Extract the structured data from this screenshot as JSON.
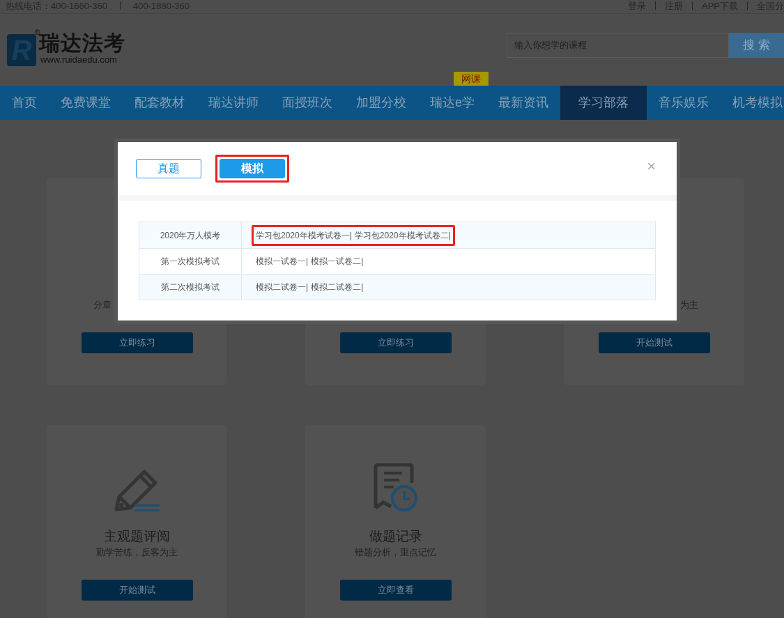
{
  "top_bar": {
    "hotline_label": "热线电话：",
    "phones": [
      "400-1660-360",
      "400-1880-360"
    ],
    "links": [
      "登录",
      "注册",
      "APP下载",
      "全国分"
    ]
  },
  "header": {
    "logo": {
      "mark": "R",
      "registered": "®",
      "name": "瑞达法考",
      "url": "www.ruidaedu.com"
    },
    "search": {
      "placeholder": "输入你想学的课程",
      "button": "搜 索"
    }
  },
  "nav": [
    {
      "label": "首页",
      "selected": false
    },
    {
      "label": "免费课堂",
      "selected": false
    },
    {
      "label": "配套教材",
      "selected": false
    },
    {
      "label": "瑞达讲师",
      "selected": false
    },
    {
      "label": "面授班次",
      "selected": false
    },
    {
      "label": "加盟分校",
      "selected": false
    },
    {
      "label": "瑞达e学",
      "selected": false,
      "badge": "网课"
    },
    {
      "label": "最新资讯",
      "selected": false
    },
    {
      "label": "学习部落",
      "selected": true
    },
    {
      "label": "音乐娱乐",
      "selected": false
    },
    {
      "label": "机考模拟",
      "selected": false
    }
  ],
  "cards": [
    {
      "subtitle": "分章",
      "button": "立即练习"
    },
    {
      "button": "立即练习"
    },
    {
      "subtitle": "为主",
      "button": "开始测试"
    },
    {
      "title": "主观题评阅",
      "subtitle": "勤学苦练，反客为主",
      "button": "开始测试"
    },
    {
      "title": "做题记录",
      "subtitle": "错题分析，重点记忆",
      "button": "立即查看"
    }
  ],
  "modal": {
    "close": "×",
    "tabs": [
      {
        "label": "真题",
        "selected": false,
        "highlighted": false
      },
      {
        "label": "模拟",
        "selected": true,
        "highlighted": true
      }
    ],
    "rows": [
      {
        "name": "2020年万人模考",
        "papers": [
          "学习包2020年模考试卷一|",
          "学习包2020年模考试卷二|"
        ],
        "highlighted": true
      },
      {
        "name": "第一次模拟考试",
        "papers": [
          "模拟一试卷一|",
          "模拟一试卷二|"
        ],
        "highlighted": false
      },
      {
        "name": "第二次模拟考试",
        "papers": [
          "模拟二试卷一|",
          "模拟二试卷二|"
        ],
        "highlighted": false
      }
    ]
  }
}
